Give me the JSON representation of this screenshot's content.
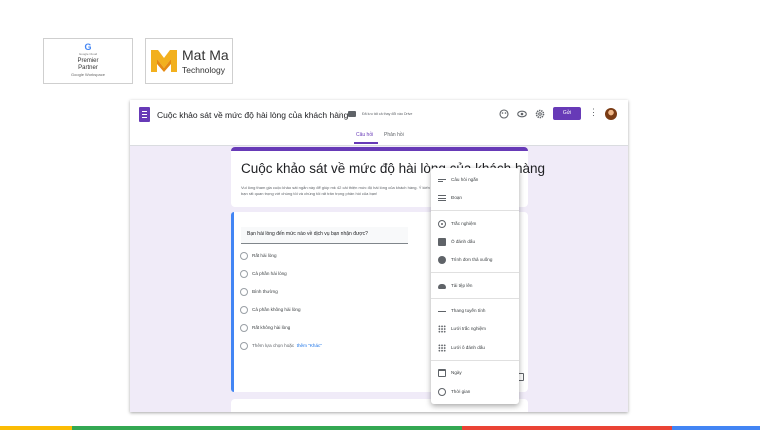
{
  "badges": {
    "google": {
      "g": "G",
      "line1": "Google Cloud",
      "line2": "Premier",
      "line3": "Partner",
      "line4": "Google Workspace"
    },
    "matma": {
      "line1": "Mat Ma",
      "line2": "Technology"
    }
  },
  "topbar": {
    "title": "Cuộc khảo sát về mức độ hài lòng của khách hàng",
    "saved": "Đã lưu tất cả thay đổi vào Drive",
    "send_label": "Gửi",
    "more": "⋮"
  },
  "tabs": [
    {
      "label": "Câu hỏi",
      "active": true
    },
    {
      "label": "Phản hồi",
      "active": false
    }
  ],
  "form": {
    "title": "Cuộc khảo sát về mức độ hài lòng của khách hàng",
    "description": "Vui lòng tham gia cuộc khảo sát ngắn này để giúp mk 42 cải thiện mức độ hài lòng của khách hàng. Ý kiến của bạn rất quan trọng với chúng tôi và chúng tôi rất trân trọng phản hồi của bạn!"
  },
  "question": {
    "text": "Bạn hài lòng đến mức nào về dịch vụ bạn nhận được?",
    "options": [
      "Rất hài lòng",
      "Cả phần hài lòng",
      "Bình thường",
      "Cả phần không hài lòng",
      "Rất không hài lòng"
    ],
    "other_prefix": "Thêm lựa chọn hoặc",
    "other_link": "thêm \"Khác\""
  },
  "menu": {
    "items": [
      {
        "label": "Câu hỏi ngắn",
        "icon": "short-answer-icon"
      },
      {
        "label": "Đoạn",
        "icon": "paragraph-icon"
      },
      {
        "label": "Trắc nghiệm",
        "icon": "radio-icon"
      },
      {
        "label": "Ô đánh dấu",
        "icon": "checkbox-icon"
      },
      {
        "label": "Trình đơn thả xuống",
        "icon": "dropdown-icon"
      },
      {
        "label": "Tải tệp lên",
        "icon": "cloud-upload-icon"
      },
      {
        "label": "Thang tuyến tính",
        "icon": "linear-scale-icon"
      },
      {
        "label": "Lưới trắc nghiệm",
        "icon": "grid-icon"
      },
      {
        "label": "Lưới ô đánh dấu",
        "icon": "checkbox-grid-icon"
      },
      {
        "label": "Ngày",
        "icon": "calendar-icon"
      },
      {
        "label": "Thời gian",
        "icon": "clock-icon"
      }
    ]
  },
  "colors": {
    "accent": "#673ab7",
    "blue": "#4285f4",
    "green": "#34a853",
    "yellow": "#fbbc04",
    "red": "#ea4335"
  }
}
